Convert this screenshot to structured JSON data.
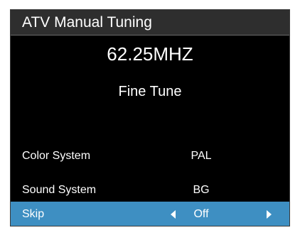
{
  "title": "ATV Manual Tuning",
  "frequency": "62.25MHZ",
  "fine_tune_label": "Fine Tune",
  "menu": {
    "color_system": {
      "label": "Color System",
      "value": "PAL"
    },
    "sound_system": {
      "label": "Sound System",
      "value": "BG"
    },
    "skip": {
      "label": "Skip",
      "value": "Off"
    }
  },
  "colors": {
    "background": "#000000",
    "title_bar": "#2e2e2e",
    "highlight": "#3e8fc2",
    "text": "#ffffff"
  },
  "icons": {
    "left": "triangle-left-icon",
    "right": "triangle-right-icon"
  }
}
